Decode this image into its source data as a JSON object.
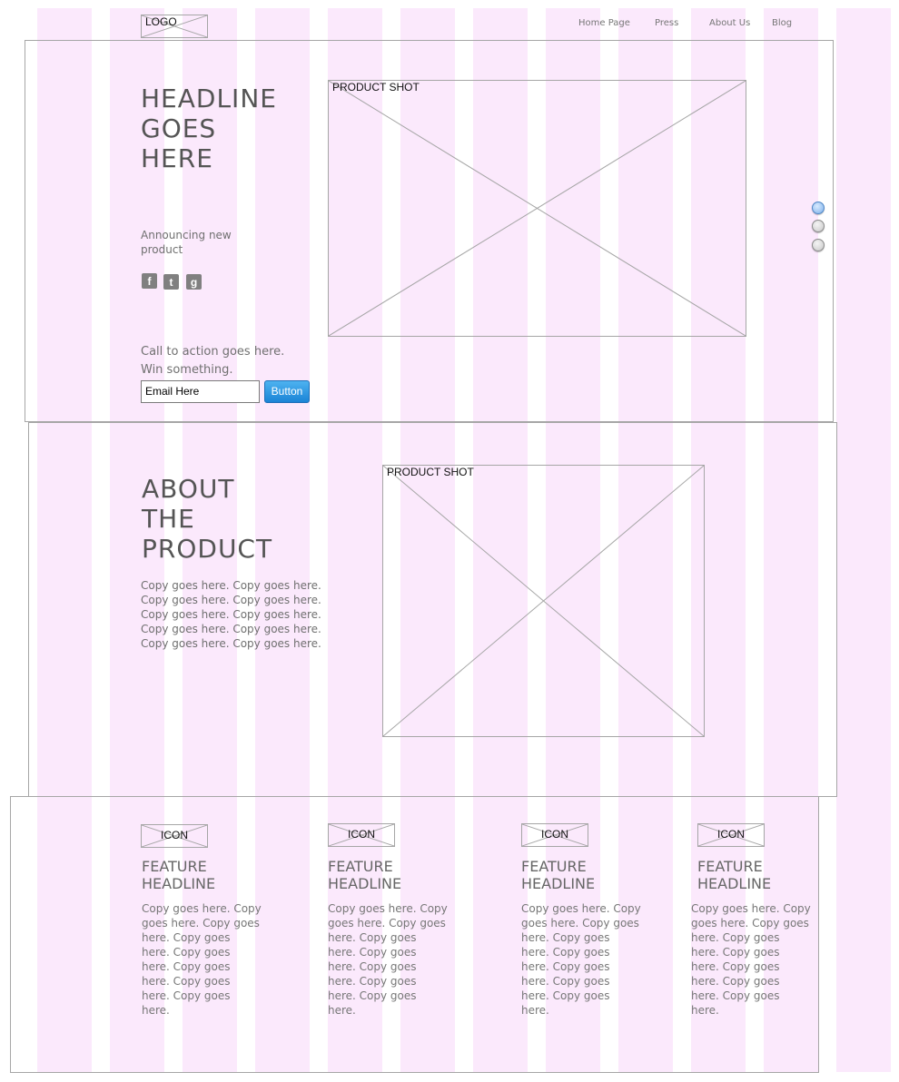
{
  "header": {
    "logo_label": "LOGO",
    "nav": [
      "Home Page",
      "Press",
      "About Us",
      "Blog"
    ]
  },
  "hero": {
    "headline": "HEADLINE\nGOES\nHERE",
    "announcement": "Announcing new\nproduct",
    "social_icons": [
      "facebook-icon",
      "twitter-icon",
      "google-plus-icon"
    ],
    "social_glyphs": [
      "f",
      "t",
      "g"
    ],
    "product_shot_label": "PRODUCT SHOT",
    "cta_line1": "Call to action goes here.",
    "cta_line2": "Win something.",
    "email_value": "Email Here",
    "button_label": "Button",
    "carousel": {
      "count": 3,
      "active_index": 0
    }
  },
  "about": {
    "headline": "ABOUT\nTHE\nPRODUCT",
    "copy": "Copy goes here. Copy goes here.\nCopy goes here. Copy goes here.\nCopy goes here. Copy goes here.\nCopy goes here. Copy goes here.\nCopy goes here. Copy goes here.",
    "product_shot_label": "PRODUCT SHOT"
  },
  "features": [
    {
      "icon_label": "ICON",
      "headline": "FEATURE\nHEADLINE",
      "copy": "Copy goes here. Copy goes here. Copy goes here. Copy goes here. Copy goes here. Copy goes here. Copy goes here. Copy goes here."
    },
    {
      "icon_label": "ICON",
      "headline": "FEATURE\nHEADLINE",
      "copy": "Copy goes here. Copy goes here. Copy goes here. Copy goes here. Copy goes here. Copy goes here. Copy goes here. Copy goes here."
    },
    {
      "icon_label": "ICON",
      "headline": "FEATURE\nHEADLINE",
      "copy": "Copy goes here. Copy goes here. Copy goes here. Copy goes here. Copy goes here. Copy goes here. Copy goes here. Copy goes here."
    },
    {
      "icon_label": "ICON",
      "headline": "FEATURE\nHEADLINE",
      "copy": "Copy goes here. Copy goes here. Copy goes here. Copy goes here. Copy goes here. Copy goes here. Copy goes here. Copy goes here."
    }
  ],
  "colors": {
    "grid_column": "#fbe9fc",
    "placeholder_stroke": "#a6a6a6",
    "button_blue": "#1b84d6",
    "carousel_active": "#7eb0ea"
  }
}
